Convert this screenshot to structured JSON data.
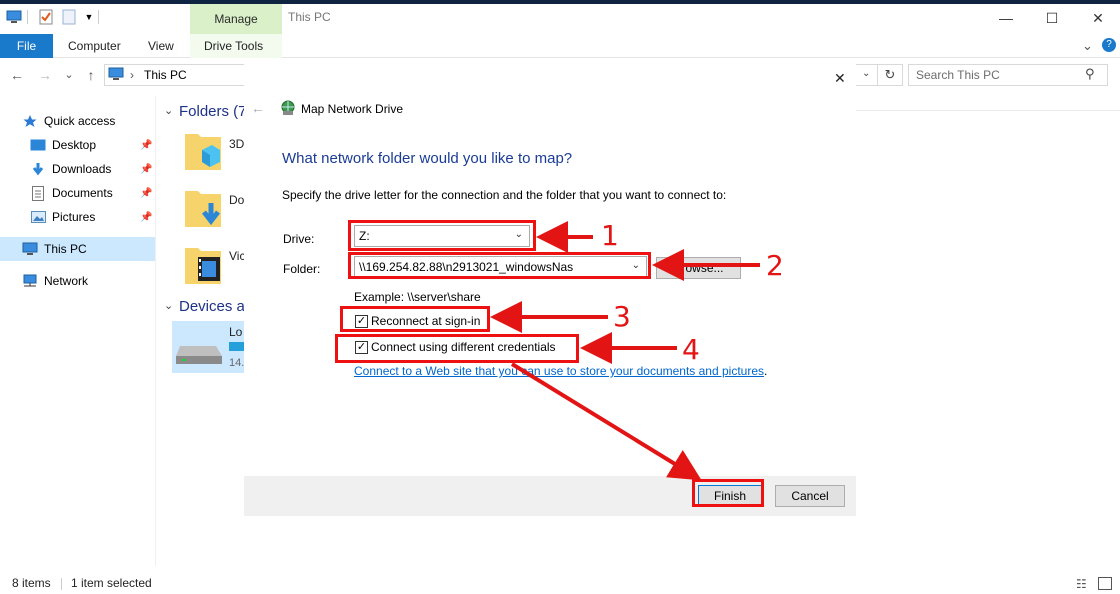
{
  "window": {
    "title": "This PC",
    "ribbon_context_tab": "Manage",
    "minimize_glyph": "—",
    "maximize_glyph": "☐",
    "close_glyph": "✕",
    "expand_glyph": "⌄",
    "help_glyph": "?"
  },
  "ribbon": {
    "tabs": [
      "File",
      "Computer",
      "View",
      "Drive Tools"
    ]
  },
  "address": {
    "breadcrumb_sep": "›",
    "path": "This PC",
    "search_placeholder": "Search This PC",
    "back_glyph": "←",
    "forward_glyph": "→",
    "recent_glyph": "⌄",
    "up_glyph": "↑",
    "refresh_glyph": "↻",
    "search_glyph": "⚲"
  },
  "nav": {
    "items": [
      {
        "label": "Quick access",
        "icon": "star-icon"
      },
      {
        "label": "Desktop",
        "icon": "desktop-icon",
        "pinned": true
      },
      {
        "label": "Downloads",
        "icon": "download-icon",
        "pinned": true
      },
      {
        "label": "Documents",
        "icon": "documents-icon",
        "pinned": true
      },
      {
        "label": "Pictures",
        "icon": "pictures-icon",
        "pinned": true
      },
      {
        "label": "This PC",
        "icon": "computer-icon",
        "selected": true
      },
      {
        "label": "Network",
        "icon": "network-icon"
      }
    ]
  },
  "content": {
    "folders_header": "Folders (7",
    "folders": [
      {
        "label": "3D"
      },
      {
        "label": "Do"
      },
      {
        "label": "Vic"
      }
    ],
    "devices_header": "Devices a",
    "device_name": "Lo",
    "device_size": "14."
  },
  "dialog": {
    "title": "Map Network Drive",
    "heading": "What network folder would you like to map?",
    "description": "Specify the drive letter for the connection and the folder that you want to connect to:",
    "drive_label": "Drive:",
    "drive_value": "Z:",
    "folder_label": "Folder:",
    "folder_value": "\\\\169.254.82.88\\n2913021_windowsNas",
    "browse_label": "Browse...",
    "example": "Example: \\\\server\\share",
    "reconnect_label": "Reconnect at sign-in",
    "reconnect_checked": true,
    "credentials_label": "Connect using different credentials",
    "credentials_checked": true,
    "link_text": "Connect to a Web site that you can use to store your documents and pictures",
    "link_suffix": ".",
    "finish_label": "Finish",
    "cancel_label": "Cancel",
    "close_glyph": "✕",
    "back_glyph": "←"
  },
  "annotations": {
    "labels": [
      "1",
      "2",
      "3",
      "4"
    ],
    "color": "#ee1111"
  },
  "status": {
    "items_count": "8 items",
    "selection": "1 item selected"
  }
}
